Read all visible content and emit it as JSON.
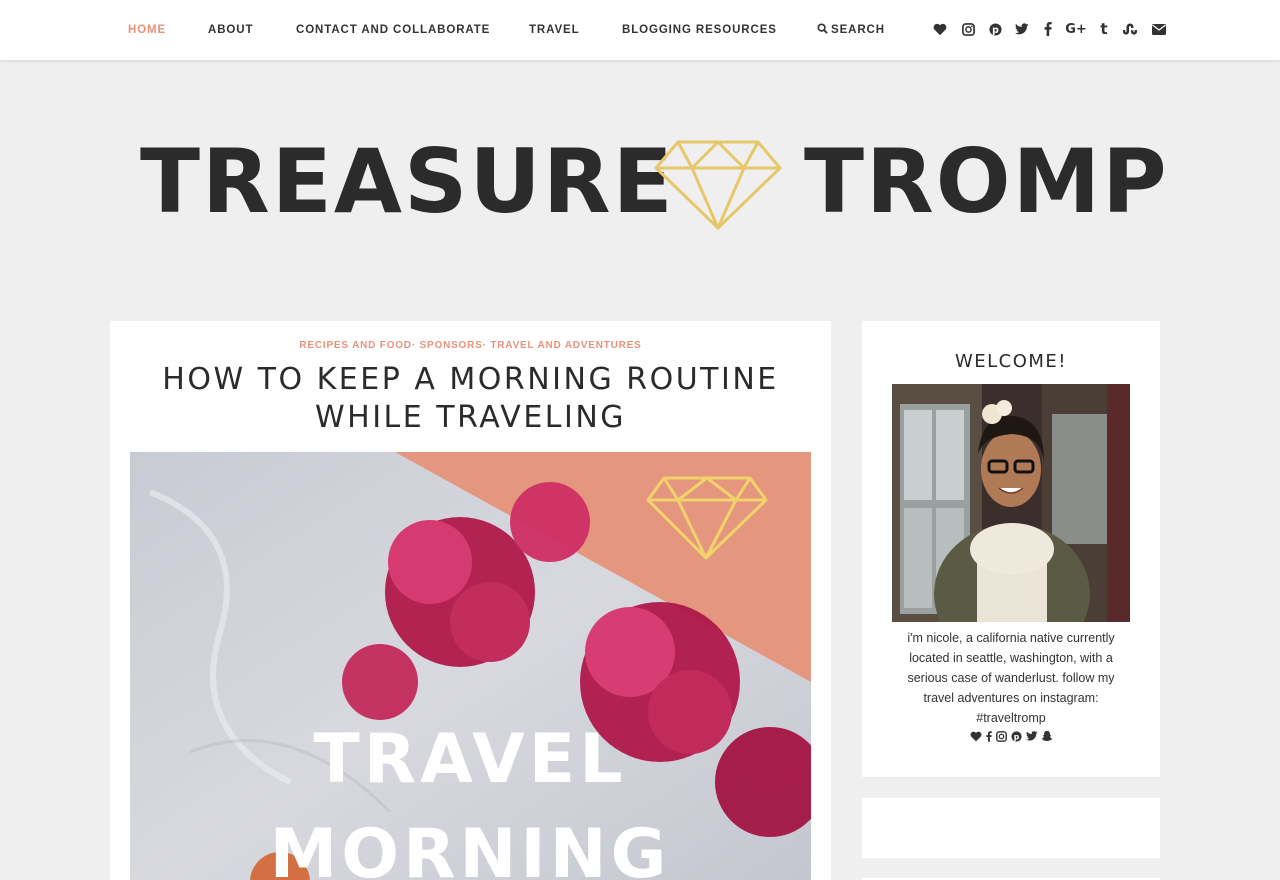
{
  "nav": {
    "items": [
      {
        "label": "HOME"
      },
      {
        "label": "ABOUT"
      },
      {
        "label": "CONTACT AND COLLABORATE"
      },
      {
        "label": "TRAVEL"
      },
      {
        "label": "BLOGGING RESOURCES"
      }
    ],
    "search_label": "SEARCH",
    "social_icons": [
      "heart-icon",
      "instagram-icon",
      "pinterest-icon",
      "twitter-icon",
      "facebook-icon",
      "google-plus-icon",
      "tumblr-icon",
      "stumbleupon-icon",
      "envelope-icon"
    ]
  },
  "logo": {
    "left": "TREASURE",
    "right": "TROMP",
    "color": "#e6c76a"
  },
  "post": {
    "categories": [
      "RECIPES AND FOOD",
      "SPONSORS",
      "TRAVEL AND ADVENTURES"
    ],
    "title": "HOW TO KEEP A MORNING ROUTINE WHILE TRAVELING",
    "image_text_line1": "TRAVEL",
    "image_text_line2": "MORNING"
  },
  "sidebar": {
    "welcome": {
      "title": "WELCOME!",
      "bio": "i'm nicole, a california native currently located in seattle, washington, with a serious case of wanderlust. follow my travel adventures on instagram: #traveltromp",
      "social_icons": [
        "heart-icon",
        "facebook-icon",
        "instagram-icon",
        "pinterest-icon",
        "twitter-icon",
        "snapchat-icon"
      ]
    }
  },
  "colors": {
    "accent": "#e8927c",
    "gold": "#e6c76a",
    "text": "#2b2b2b",
    "background": "#efefef"
  }
}
